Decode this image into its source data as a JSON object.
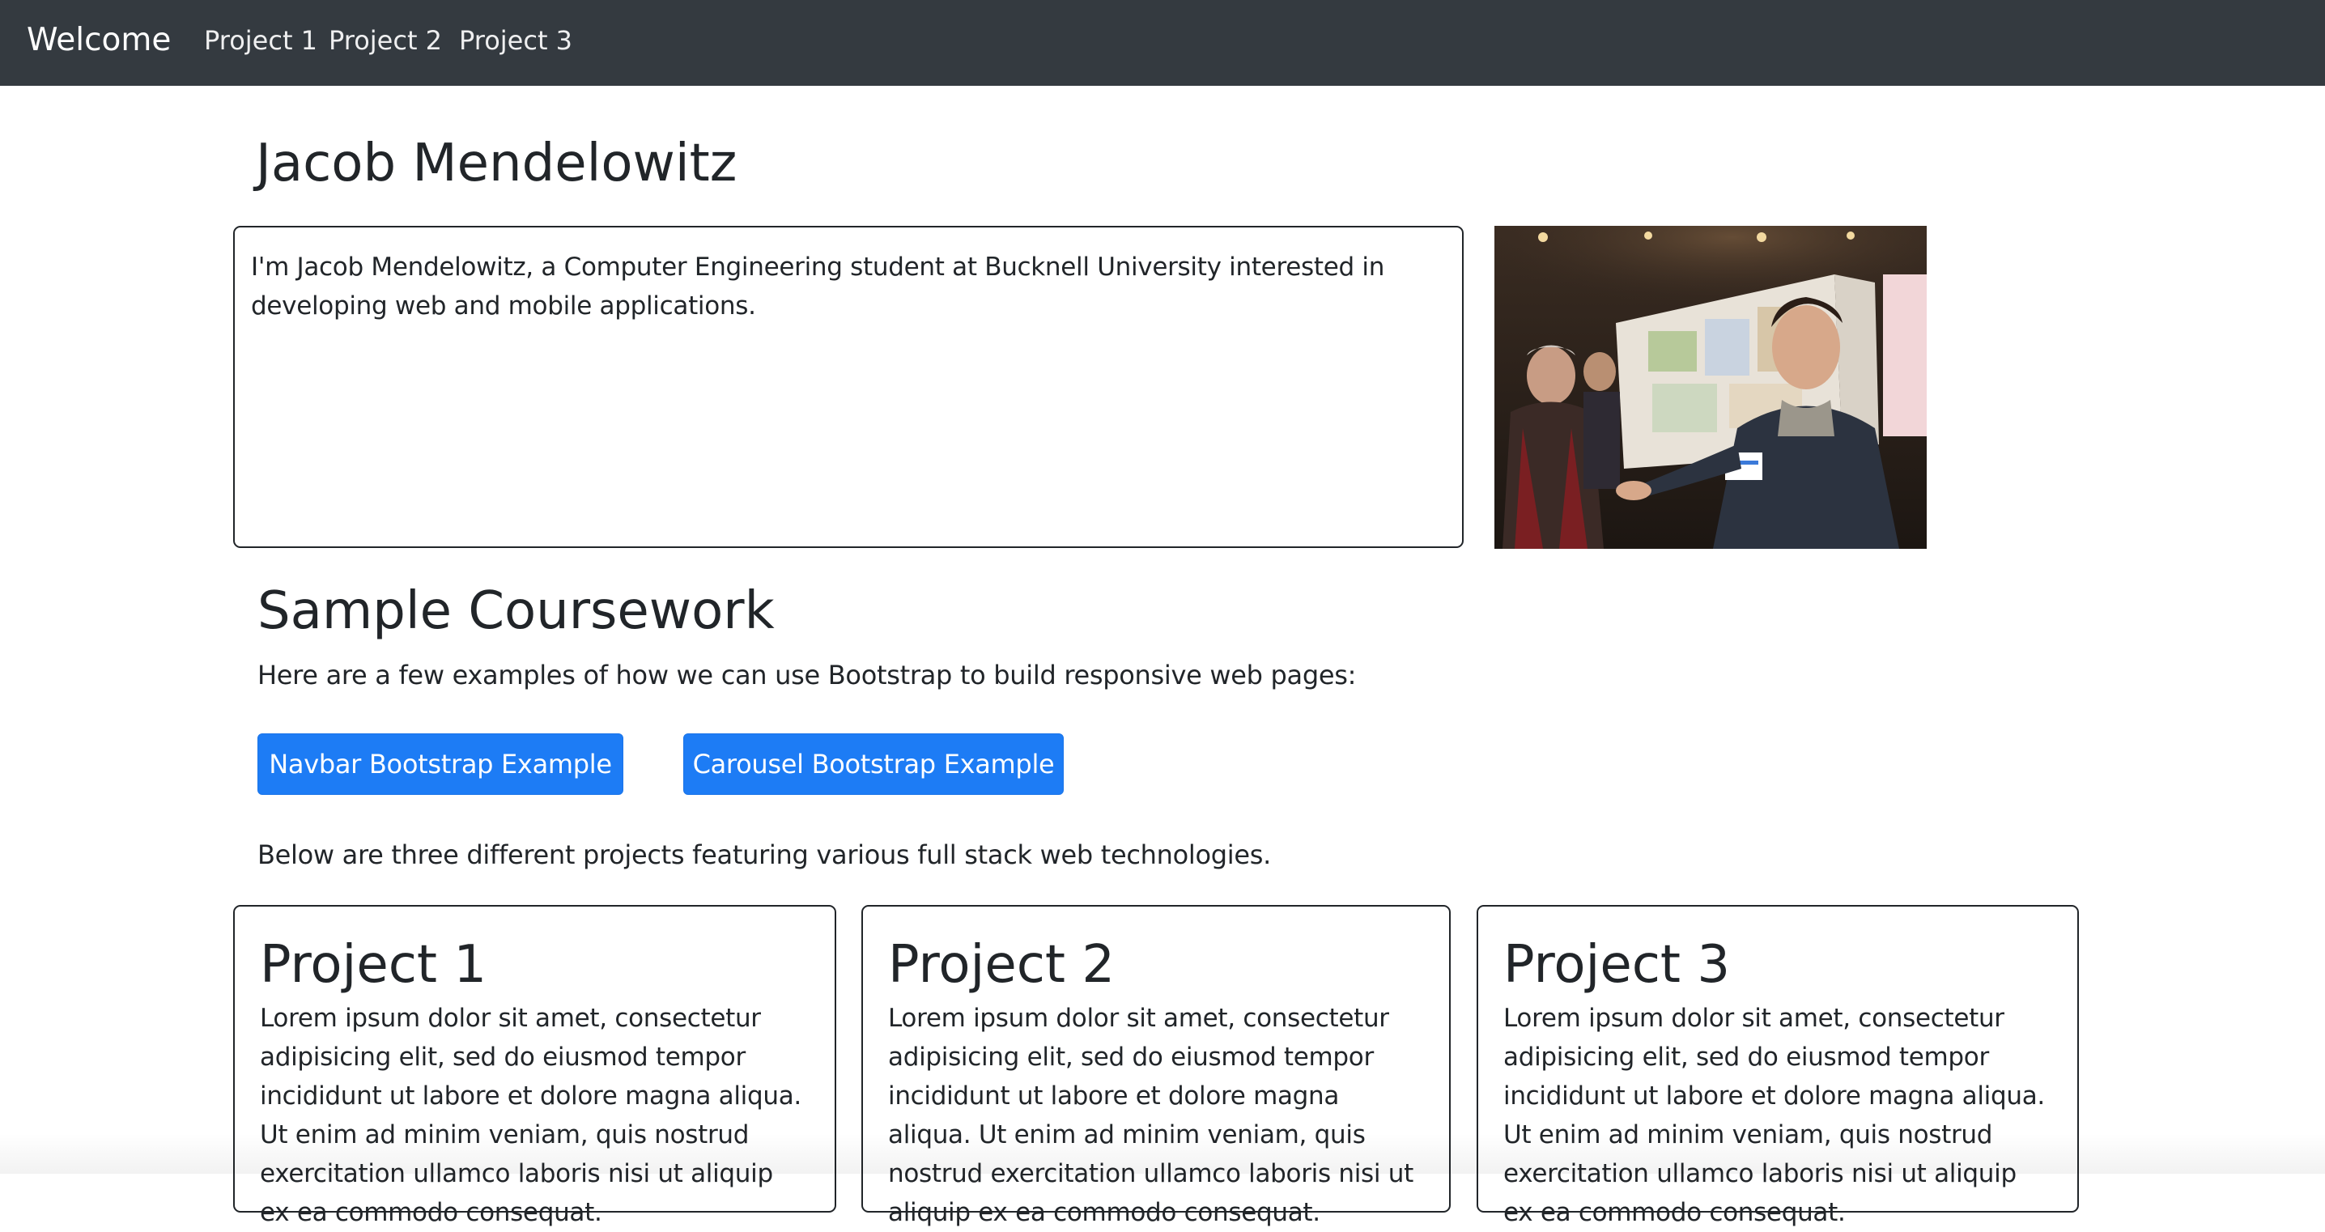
{
  "navbar": {
    "brand": "Welcome",
    "links": [
      {
        "label": "Project 1"
      },
      {
        "label": "Project 2"
      },
      {
        "label": "Project 3"
      }
    ]
  },
  "header": {
    "name": "Jacob Mendelowitz"
  },
  "intro": {
    "text": "I'm Jacob Mendelowitz, a Computer Engineering student at Bucknell University interested in developing web and mobile applications."
  },
  "coursework": {
    "heading": "Sample Coursework",
    "description": "Here are a few examples of how we can use Bootstrap to build responsive web pages:",
    "buttons": [
      {
        "label": "Navbar Bootstrap Example"
      },
      {
        "label": "Carousel Bootstrap Example"
      }
    ],
    "projects_intro": "Below are three different projects featuring various full stack web technologies."
  },
  "projects": [
    {
      "title": "Project 1",
      "text": "Lorem ipsum dolor sit amet, consectetur adipisicing elit, sed do eiusmod tempor incididunt ut labore et dolore magna aliqua. Ut enim ad minim veniam, quis nostrud exercitation ullamco laboris nisi ut aliquip ex ea commodo consequat."
    },
    {
      "title": "Project 2",
      "text": "Lorem ipsum dolor sit amet, consectetur adipisicing elit, sed do eiusmod tempor incididunt ut labore et dolore magna aliqua. Ut enim ad minim veniam, quis nostrud exercitation ullamco laboris nisi ut aliquip ex ea commodo consequat."
    },
    {
      "title": "Project 3",
      "text": "Lorem ipsum dolor sit amet, consectetur adipisicing elit, sed do eiusmod tempor incididunt ut labore et dolore magna aliqua. Ut enim ad minim veniam, quis nostrud exercitation ullamco laboris nisi ut aliquip ex ea commodo consequat."
    }
  ],
  "colors": {
    "navbar_bg": "#343a40",
    "button_primary": "#1d7cf5",
    "text": "#212529"
  }
}
